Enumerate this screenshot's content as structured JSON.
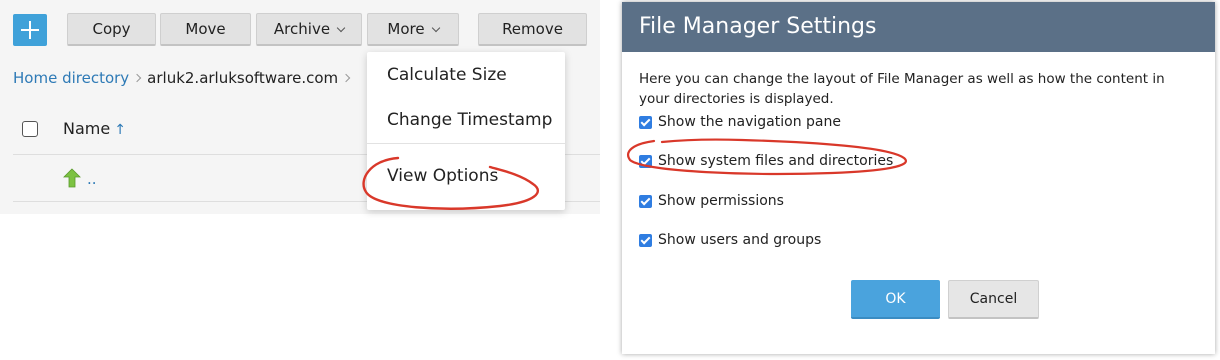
{
  "toolbar": {
    "copy_label": "Copy",
    "move_label": "Move",
    "archive_label": "Archive",
    "more_label": "More",
    "remove_label": "Remove",
    "accent_color": "#3fa1d9"
  },
  "breadcrumb": {
    "home": "Home directory",
    "current": "arluk2.arluksoftware.com"
  },
  "file_list": {
    "columns": {
      "name": "Name",
      "sort_indicator": "↑"
    },
    "rows": [
      {
        "icon": "up-arrow-icon",
        "name": ".."
      }
    ]
  },
  "more_menu": {
    "items": [
      "Calculate Size",
      "Change Timestamp",
      "View Options"
    ]
  },
  "dialog": {
    "title": "File Manager Settings",
    "description": "Here you can change the layout of File Manager as well as how the content in your directories is displayed.",
    "options": [
      {
        "label": "Show the navigation pane",
        "checked": true
      },
      {
        "label": "Show system files and directories",
        "checked": true
      },
      {
        "label": "Show permissions",
        "checked": true
      },
      {
        "label": "Show users and groups",
        "checked": true
      }
    ],
    "ok_label": "OK",
    "cancel_label": "Cancel",
    "header_color": "#5b7087",
    "annotation_color": "#d9382a"
  }
}
